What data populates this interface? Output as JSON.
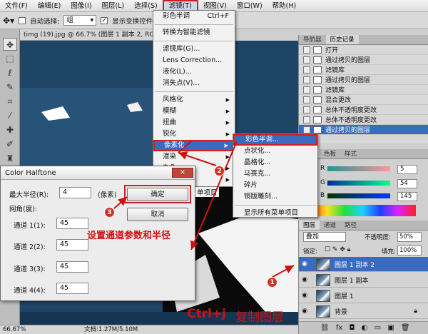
{
  "menubar": {
    "items": [
      "文件(F)",
      "编辑(E)",
      "图像(I)",
      "图层(L)",
      "选择(S)",
      "滤镜(T)",
      "视图(V)",
      "窗口(W)",
      "帮助(H)"
    ],
    "active_index": 5
  },
  "optionsbar": {
    "auto_select_label": "自动选择:",
    "auto_select_value": "组",
    "show_transform_label": "显示变换控件"
  },
  "document": {
    "tab_title": "timg (19).jpg @ 66.7% (图层 1 副本 2, RGB/8#)"
  },
  "statusbar": {
    "zoom": "66.67%",
    "doc_size": "文档:1.27M/5.10M"
  },
  "filter_menu": {
    "top_items": [
      {
        "label": "彩色半调",
        "shortcut": "Ctrl+F"
      },
      {
        "label": "转换为智能滤镜"
      }
    ],
    "mid_items": [
      "滤镜库(G)...",
      "Lens Correction...",
      "液化(L)...",
      "消失点(V)..."
    ],
    "sub_items": [
      "风格化",
      "模糊",
      "扭曲",
      "锐化",
      "像素化",
      "渲染",
      "杂色",
      "其它"
    ],
    "highlight": "像素化"
  },
  "pixelate_submenu": {
    "items": [
      "彩色半调...",
      "点状化...",
      "晶格化...",
      "马赛克...",
      "碎片",
      "铜版雕刻..."
    ],
    "footer": "显示所有菜单项目",
    "highlight": "彩色半调..."
  },
  "dialog": {
    "title": "Color Halftone",
    "max_radius_label": "最大半径(R):",
    "max_radius_value": "4",
    "unit": "(像素)",
    "angle_label": "网角(度):",
    "channels": [
      {
        "label": "通道 1(1):",
        "value": "45"
      },
      {
        "label": "通道 2(2):",
        "value": "45"
      },
      {
        "label": "通道 3(3):",
        "value": "45"
      },
      {
        "label": "通道 4(4):",
        "value": "45"
      }
    ],
    "ok_label": "确定",
    "cancel_label": "取消",
    "close_label": "✕"
  },
  "history_panel": {
    "tabs": [
      "导航器",
      "历史记录"
    ],
    "items": [
      "打开",
      "通过拷贝的图层",
      "滤镜库",
      "通过拷贝的图层",
      "滤镜库",
      "混合更改",
      "总体不透明度更改",
      "总体不透明度更改",
      "通过拷贝的图层"
    ],
    "active_index": 8
  },
  "color_panel": {
    "tabs": [
      "颜色",
      "色板",
      "样式"
    ],
    "channels": [
      {
        "label": "R",
        "value": "5",
        "gradient": [
          "#1e9696",
          "#ff9696"
        ]
      },
      {
        "label": "G",
        "value": "54",
        "gradient": [
          "#052d91",
          "#05ff91"
        ]
      },
      {
        "label": "B",
        "value": "145",
        "gradient": [
          "#053600",
          "#0536ff"
        ]
      }
    ]
  },
  "layers_panel": {
    "tabs": [
      "图层",
      "通道",
      "路径"
    ],
    "blend_mode": "叠加",
    "opacity_label": "不透明度:",
    "opacity_value": "50%",
    "lock_label": "锁定:",
    "fill_label": "填充:",
    "fill_value": "100%",
    "layers": [
      {
        "name": "图层 1 副本 2",
        "active": true
      },
      {
        "name": "图层 1 副本",
        "active": false
      },
      {
        "name": "图层 1",
        "active": false
      },
      {
        "name": "背景",
        "active": false
      }
    ]
  },
  "annotations": {
    "step1": "1",
    "step2": "2",
    "step3": "3",
    "param_note": "设置通道参数和半径",
    "copy_note_key": "Ctrl+j",
    "copy_note_text": "复制图层"
  },
  "colors": {
    "accent": "#3b6bbf",
    "annotation_red": "#d01010"
  }
}
